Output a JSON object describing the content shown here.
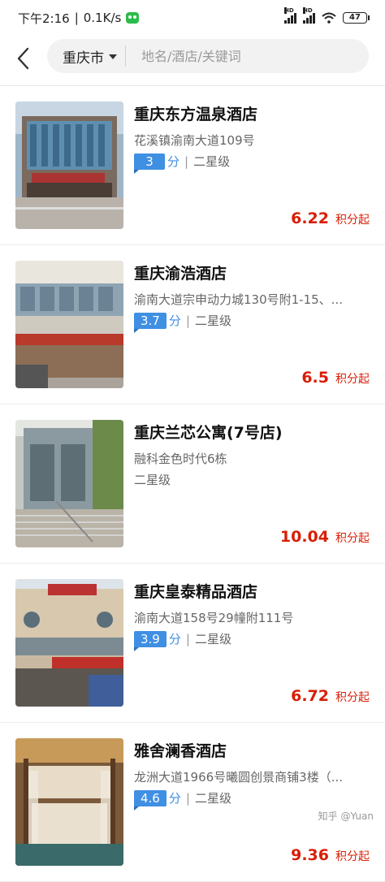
{
  "status_bar": {
    "time": "下午2:16",
    "separator": "|",
    "speed": "0.1K/s",
    "signal1_label": "HD",
    "signal2_label": "HD",
    "battery": "47"
  },
  "header": {
    "city": "重庆市",
    "search_placeholder": "地名/酒店/关键词"
  },
  "hotels": [
    {
      "name": "重庆东方温泉酒店",
      "address": "花溪镇渝南大道109号",
      "score": "3",
      "score_unit": "分",
      "star": "二星级",
      "price": "6.22",
      "price_unit": "积分起"
    },
    {
      "name": "重庆渝浩酒店",
      "address": "渝南大道宗申动力城130号附1-15、...",
      "score": "3.7",
      "score_unit": "分",
      "star": "二星级",
      "price": "6.5",
      "price_unit": "积分起"
    },
    {
      "name": "重庆兰芯公寓(7号店)",
      "address": "融科金色时代6栋",
      "score": "",
      "score_unit": "",
      "star": "二星级",
      "price": "10.04",
      "price_unit": "积分起"
    },
    {
      "name": "重庆皇泰精品酒店",
      "address": "渝南大道158号29幢附111号",
      "score": "3.9",
      "score_unit": "分",
      "star": "二星级",
      "price": "6.72",
      "price_unit": "积分起"
    },
    {
      "name": "雅舍澜香酒店",
      "address": "龙洲大道1966号曦圆创景商铺3楼（...",
      "score": "4.6",
      "score_unit": "分",
      "star": "二星级",
      "price": "9.36",
      "price_unit": "积分起"
    }
  ],
  "watermark": "知乎 @Yuan",
  "colors": {
    "accent_blue": "#3f8fe3",
    "price_red": "#d81e06"
  }
}
